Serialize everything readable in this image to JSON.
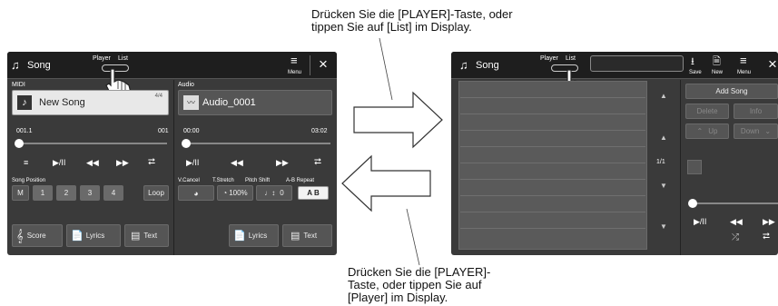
{
  "callouts": {
    "top_line1": "Drücken Sie die [PLAYER]-Taste, oder",
    "top_line2": "tippen Sie auf [List] im Display.",
    "bottom_line1": "Drücken Sie die [PLAYER]-",
    "bottom_line2": "Taste, oder tippen Sie auf",
    "bottom_line3": "[Player] im Display."
  },
  "player_screen": {
    "app_title": "Song",
    "toggle_player": "Player",
    "toggle_list": "List",
    "menu_label": "Menu",
    "close_glyph": "×",
    "midi": {
      "section_label": "MIDI",
      "song_name": "New Song",
      "page": "4/4",
      "position_start": "001.1",
      "position_end": "001",
      "song_position_label": "Song Position",
      "position_buttons": [
        "M",
        "1",
        "2",
        "3",
        "4",
        "Loop"
      ],
      "score_label": "Score",
      "lyrics_label": "Lyrics",
      "text_label": "Text"
    },
    "audio": {
      "section_label": "Audio",
      "file_name": "Audio_0001",
      "time_start": "00:00",
      "time_end": "03:02",
      "vcancel_label": "V.Cancel",
      "tstretch_label": "T.Stretch",
      "tstretch_value": "100%",
      "pitchshift_label": "Pitch Shift",
      "pitchshift_value": "0",
      "abrepeat_label": "A-B Repeat",
      "ab_button": "A B",
      "lyrics_label": "Lyrics",
      "text_label": "Text"
    }
  },
  "list_screen": {
    "app_title": "Song",
    "toggle_player": "Player",
    "toggle_list": "List",
    "save_label": "Save",
    "new_label": "New",
    "menu_label": "Menu",
    "page_indicator": "1/1",
    "add_song": "Add Song",
    "delete": "Delete",
    "info": "Info",
    "up": "Up",
    "down": "Down"
  },
  "colors": {
    "panel_bg": "#3a3a3a",
    "header_bg": "#1e1e1e",
    "list_bg": "#5a5a5a"
  }
}
